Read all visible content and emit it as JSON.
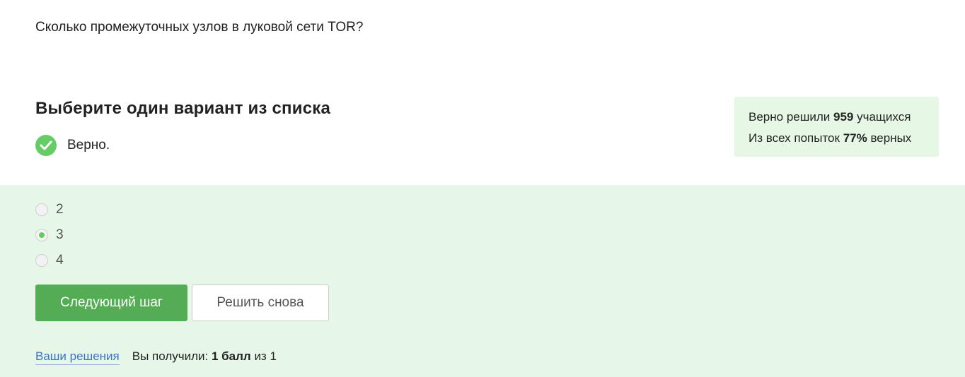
{
  "question": {
    "text": "Сколько промежуточных узлов в луковой сети TOR?"
  },
  "task": {
    "heading": "Выберите один вариант из списка",
    "verdict": "Верно."
  },
  "stats": {
    "line1_prefix": "Верно решили",
    "solved_count": "959",
    "line1_suffix": "учащихся",
    "line2_prefix": "Из всех попыток",
    "correct_percent": "77%",
    "line2_suffix": "верных"
  },
  "options": [
    {
      "label": "2",
      "checked": false
    },
    {
      "label": "3",
      "checked": true
    },
    {
      "label": "4",
      "checked": false
    }
  ],
  "buttons": {
    "next_label": "Следующий шаг",
    "retry_label": "Решить снова"
  },
  "footer": {
    "solutions_link": "Ваши решения",
    "score_prefix": "Вы получили:",
    "score_value": "1 балл",
    "score_suffix": "из 1"
  },
  "colors": {
    "accent_green": "#54ad54",
    "check_green": "#66cc66",
    "answer_bg": "#e6f7e9",
    "link_blue": "#3b73c8"
  }
}
